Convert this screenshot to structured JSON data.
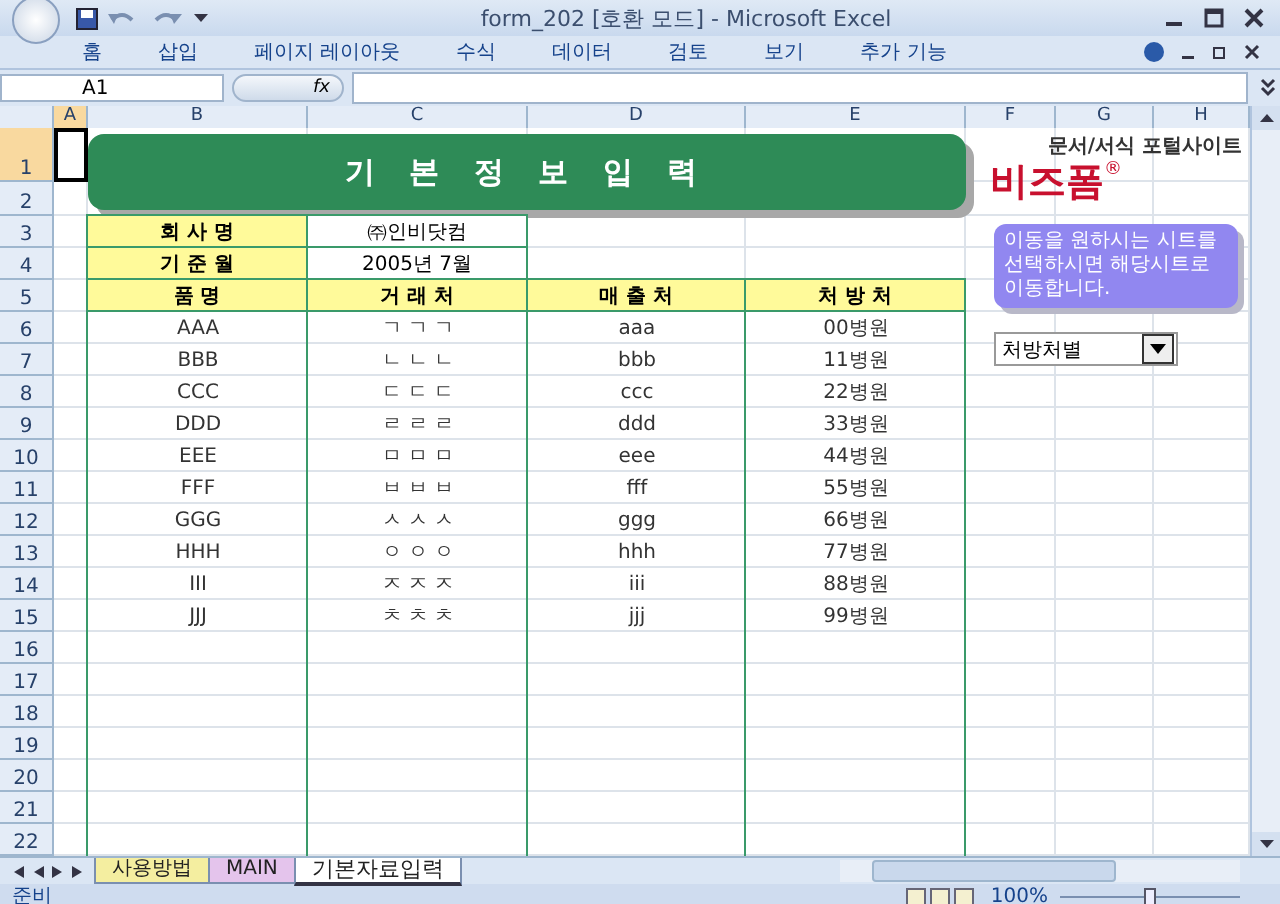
{
  "window": {
    "title": "form_202  [호환 모드] - Microsoft Excel"
  },
  "ribbon_tabs": [
    {
      "label": "홈",
      "selected": false
    },
    {
      "label": "삽입",
      "selected": false
    },
    {
      "label": "페이지 레이아웃",
      "selected": false
    },
    {
      "label": "수식",
      "selected": false
    },
    {
      "label": "데이터",
      "selected": false
    },
    {
      "label": "검토",
      "selected": false
    },
    {
      "label": "보기",
      "selected": false
    },
    {
      "label": "추가 기능",
      "selected": false
    }
  ],
  "formula_bar": {
    "name_box": "A1",
    "fx": "fx"
  },
  "columns": [
    {
      "label": "A",
      "selected": true
    },
    {
      "label": "B",
      "selected": false
    },
    {
      "label": "C",
      "selected": false
    },
    {
      "label": "D",
      "selected": false
    },
    {
      "label": "E",
      "selected": false
    },
    {
      "label": "F",
      "selected": false
    },
    {
      "label": "G",
      "selected": false
    },
    {
      "label": "H",
      "selected": false
    }
  ],
  "rows": [
    {
      "label": "1",
      "selected": true
    },
    {
      "label": "2",
      "selected": false
    },
    {
      "label": "3",
      "selected": false
    },
    {
      "label": "4",
      "selected": false
    },
    {
      "label": "5",
      "selected": false
    },
    {
      "label": "6",
      "selected": false
    },
    {
      "label": "7",
      "selected": false
    },
    {
      "label": "8",
      "selected": false
    },
    {
      "label": "9",
      "selected": false
    },
    {
      "label": "10",
      "selected": false
    },
    {
      "label": "11",
      "selected": false
    },
    {
      "label": "12",
      "selected": false
    },
    {
      "label": "13",
      "selected": false
    },
    {
      "label": "14",
      "selected": false
    },
    {
      "label": "15",
      "selected": false
    },
    {
      "label": "16",
      "selected": false
    },
    {
      "label": "17",
      "selected": false
    },
    {
      "label": "18",
      "selected": false
    },
    {
      "label": "19",
      "selected": false
    },
    {
      "label": "20",
      "selected": false
    },
    {
      "label": "21",
      "selected": false
    },
    {
      "label": "22",
      "selected": false
    }
  ],
  "sheet": {
    "title": "기 본 정 보 입 력",
    "info": [
      {
        "label": "회 사 명",
        "value": "㈜인비닷컴"
      },
      {
        "label": "기 준 월",
        "value": "2005년 7월"
      }
    ],
    "headers": [
      "품 명",
      "거 래 처",
      "매 출 처",
      "처 방 처"
    ],
    "items": [
      [
        "AAA",
        "ㄱ ㄱ ㄱ",
        "aaa",
        "00병원"
      ],
      [
        "BBB",
        "ㄴ ㄴ ㄴ",
        "bbb",
        "11병원"
      ],
      [
        "CCC",
        "ㄷ ㄷ ㄷ",
        "ccc",
        "22병원"
      ],
      [
        "DDD",
        "ㄹ ㄹ ㄹ",
        "ddd",
        "33병원"
      ],
      [
        "EEE",
        "ㅁ ㅁ ㅁ",
        "eee",
        "44병원"
      ],
      [
        "FFF",
        "ㅂ ㅂ ㅂ",
        "fff",
        "55병원"
      ],
      [
        "GGG",
        "ㅅ ㅅ ㅅ",
        "ggg",
        "66병원"
      ],
      [
        "HHH",
        "ㅇ ㅇ ㅇ",
        "hhh",
        "77병원"
      ],
      [
        "III",
        "ㅈ ㅈ ㅈ",
        "iii",
        "88병원"
      ],
      [
        "JJJ",
        "ㅊ ㅊ ㅊ",
        "jjj",
        "99병원"
      ]
    ],
    "logo": {
      "tagline": "문서/서식 포털사이트",
      "name": "비즈폼",
      "mark": "®"
    },
    "note": "이동을 원하시는 시트를 선택하시면 해당시트로 이동합니다.",
    "dropdown": {
      "value": "처방처별"
    }
  },
  "sheet_tabs": [
    {
      "label": "사용방법",
      "selected": false,
      "color": "#f4eea0"
    },
    {
      "label": "MAIN",
      "selected": false,
      "color": "#e4c4ec"
    },
    {
      "label": "기본자료입력",
      "selected": true,
      "color": "#ffffff"
    }
  ],
  "status_bar": {
    "text": "준비",
    "zoom": "100%",
    "level": 0.5
  }
}
